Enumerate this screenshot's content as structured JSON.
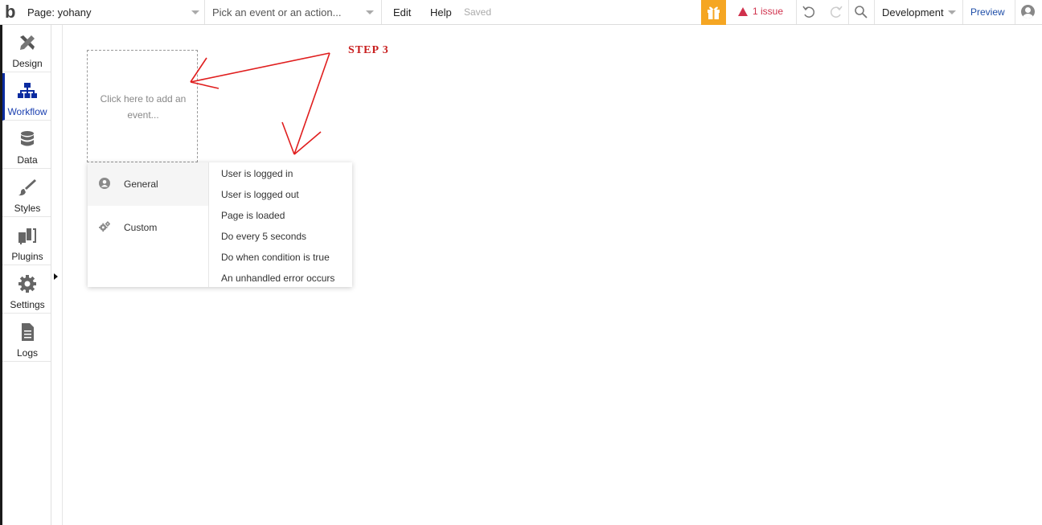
{
  "topbar": {
    "logo": "b",
    "page_label": "Page: yohany",
    "event_placeholder": "Pick an event or an action...",
    "edit": "Edit",
    "help": "Help",
    "saved": "Saved",
    "issue": "1 issue",
    "environment": "Development",
    "preview": "Preview"
  },
  "sidebar": {
    "tabs": [
      {
        "label": "Design",
        "icon": "design-icon"
      },
      {
        "label": "Workflow",
        "icon": "workflow-icon"
      },
      {
        "label": "Data",
        "icon": "database-icon"
      },
      {
        "label": "Styles",
        "icon": "brush-icon"
      },
      {
        "label": "Plugins",
        "icon": "plugin-icon"
      },
      {
        "label": "Settings",
        "icon": "gear-icon"
      },
      {
        "label": "Logs",
        "icon": "document-icon"
      }
    ],
    "active": "Workflow"
  },
  "canvas": {
    "event_box_text": "Click here to add an event..."
  },
  "dropdown": {
    "categories": [
      {
        "label": "General",
        "icon": "user-icon"
      },
      {
        "label": "Custom",
        "icon": "gears-icon"
      }
    ],
    "options": [
      "User is logged in",
      "User is logged out",
      "Page is loaded",
      "Do every 5 seconds",
      "Do when condition is true",
      "An unhandled error occurs"
    ]
  },
  "annotation": {
    "label": "STEP  3",
    "color": "#c81e1e"
  },
  "colors": {
    "accent": "#0a2ba0",
    "gift": "#f5a623",
    "issue": "#d0314c",
    "preview": "#1f4ea8"
  }
}
